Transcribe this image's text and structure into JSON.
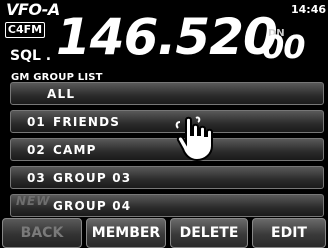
{
  "header": {
    "vfo": "VFO-A",
    "mode": "C4FM",
    "sql": "SQL .",
    "frequency_main": "146.520",
    "frequency_small": "00",
    "dn": "DN",
    "clock": "14:46"
  },
  "list": {
    "title": "GM GROUP LIST",
    "items": [
      {
        "num": "",
        "name": "ALL"
      },
      {
        "num": "01",
        "name": "FRIENDS"
      },
      {
        "num": "02",
        "name": "CAMP"
      },
      {
        "num": "03",
        "name": "GROUP 03"
      },
      {
        "num": "",
        "name": "GROUP 04"
      }
    ],
    "new_label": "NEW"
  },
  "buttons": {
    "back": "BACK",
    "member": "MEMBER",
    "delete": "DELETE",
    "edit": "EDIT"
  },
  "icons": {
    "touch": "hand-pointer-icon"
  }
}
